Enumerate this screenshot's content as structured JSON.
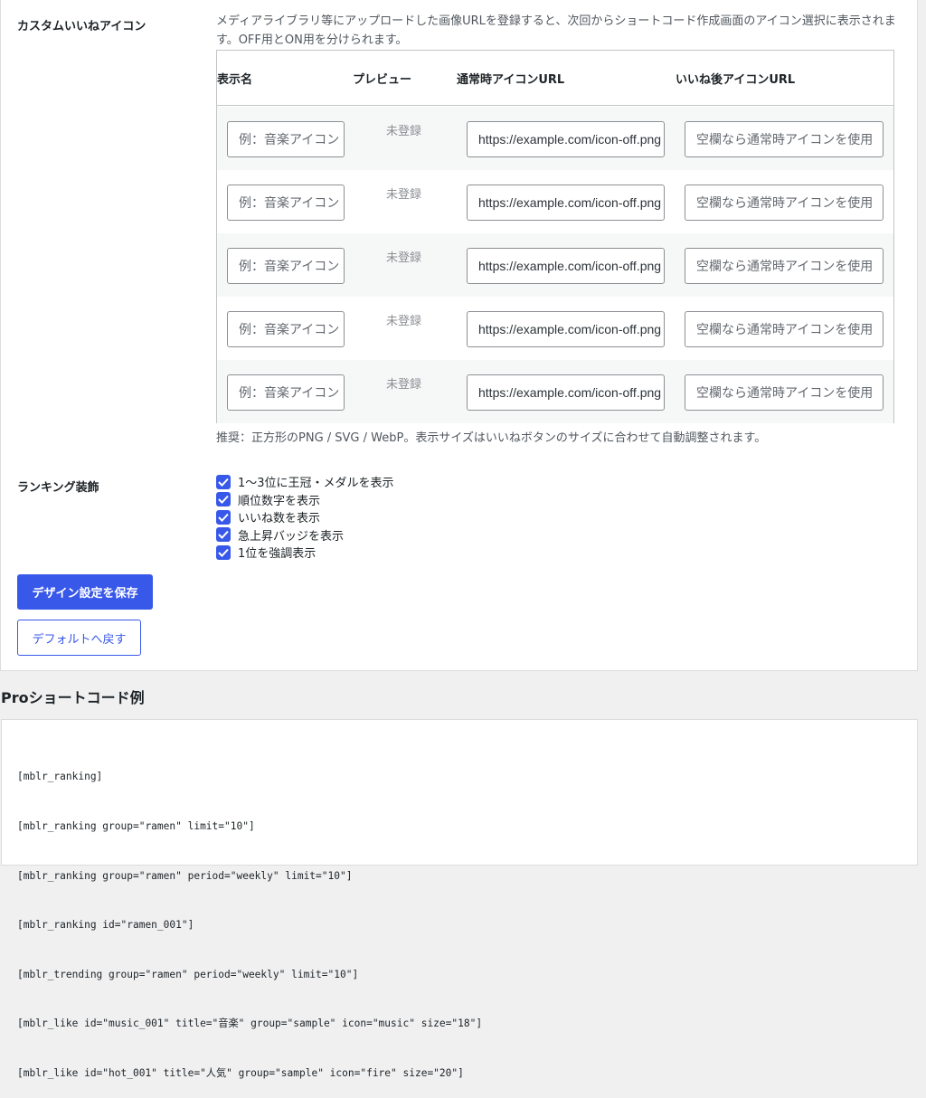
{
  "custom_icon": {
    "label": "カスタムいいねアイコン",
    "description": "メディアライブラリ等にアップロードした画像URLを登録すると、次回からショートコード作成画面のアイコン選択に表示されます。OFF用とON用を分けられます。",
    "columns": [
      "表示名",
      "プレビュー",
      "通常時アイコンURL",
      "いいね後アイコンURL"
    ],
    "rows": [
      {
        "name_placeholder": "例：音楽アイコン",
        "preview": "未登録",
        "off_url": "https://example.com/icon-off.png",
        "on_placeholder": "空欄なら通常時アイコンを使用"
      },
      {
        "name_placeholder": "例：音楽アイコン",
        "preview": "未登録",
        "off_url": "https://example.com/icon-off.png",
        "on_placeholder": "空欄なら通常時アイコンを使用"
      },
      {
        "name_placeholder": "例：音楽アイコン",
        "preview": "未登録",
        "off_url": "https://example.com/icon-off.png",
        "on_placeholder": "空欄なら通常時アイコンを使用"
      },
      {
        "name_placeholder": "例：音楽アイコン",
        "preview": "未登録",
        "off_url": "https://example.com/icon-off.png",
        "on_placeholder": "空欄なら通常時アイコンを使用"
      },
      {
        "name_placeholder": "例：音楽アイコン",
        "preview": "未登録",
        "off_url": "https://example.com/icon-off.png",
        "on_placeholder": "空欄なら通常時アイコンを使用"
      }
    ],
    "note": "推奨：正方形のPNG / SVG / WebP。表示サイズはいいねボタンのサイズに合わせて自動調整されます。"
  },
  "ranking": {
    "label": "ランキング装飾",
    "options": [
      {
        "label": "1〜3位に王冠・メダルを表示",
        "checked": true
      },
      {
        "label": "順位数字を表示",
        "checked": true
      },
      {
        "label": "いいね数を表示",
        "checked": true
      },
      {
        "label": "急上昇バッジを表示",
        "checked": true
      },
      {
        "label": "1位を強調表示",
        "checked": true
      }
    ]
  },
  "buttons": {
    "save": "デザイン設定を保存",
    "reset": "デフォルトへ戻す"
  },
  "pro": {
    "title": "Proショートコード例",
    "code_lines": [
      "[mblr_ranking]",
      "[mblr_ranking group=\"ramen\" limit=\"10\"]",
      "[mblr_ranking group=\"ramen\" period=\"weekly\" limit=\"10\"]",
      "[mblr_ranking id=\"ramen_001\"]",
      "[mblr_trending group=\"ramen\" period=\"weekly\" limit=\"10\"]",
      "[mblr_like id=\"music_001\" title=\"音楽\" group=\"sample\" icon=\"music\" size=\"18\"]",
      "[mblr_like id=\"hot_001\" title=\"人気\" group=\"sample\" icon=\"fire\" size=\"20\"]"
    ]
  },
  "colors": {
    "accent": "#3858e9",
    "page_bg": "#f0f0f1",
    "row_alt": "#f6f7f7"
  }
}
